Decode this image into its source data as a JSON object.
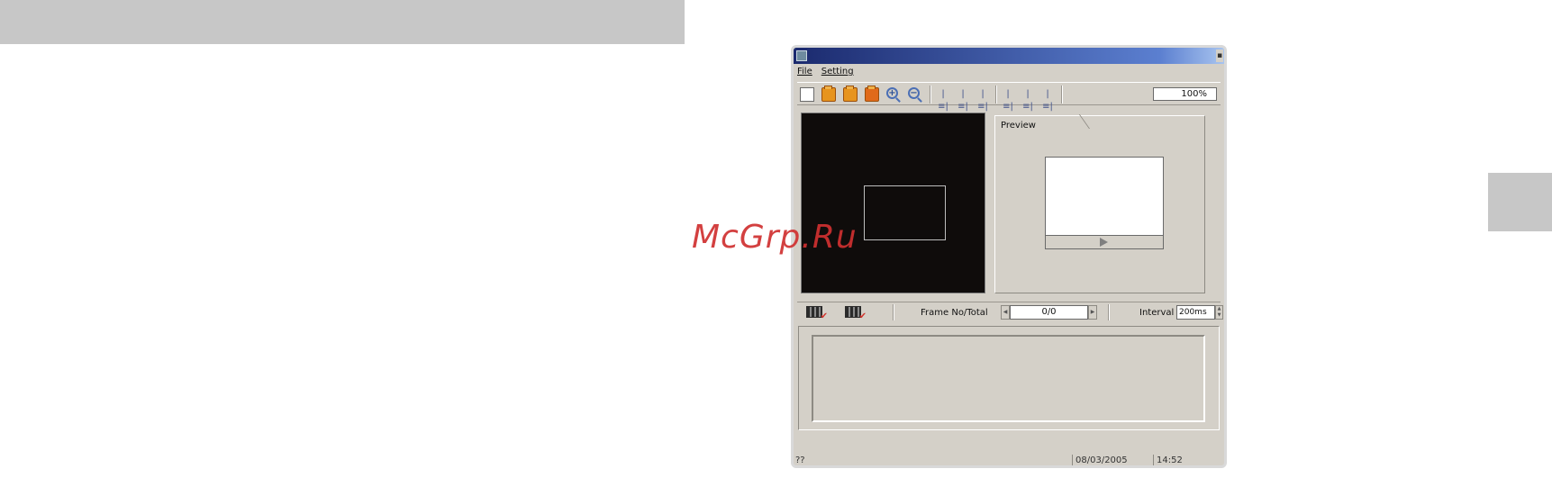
{
  "watermark": "McGrp.Ru",
  "menu": {
    "file": "File",
    "setting": "Setting"
  },
  "toolbar": {
    "zoom_in_symbol": "+",
    "zoom_out_symbol": "−",
    "align_symbol": "|≡|",
    "zoom_value": "100%"
  },
  "preview": {
    "tab_label": "Preview"
  },
  "frame_bar": {
    "frame_label": "Frame No/Total",
    "frame_value": "0/0",
    "prev_arrow": "◀",
    "next_arrow": "▶",
    "interval_label": "Interval",
    "interval_value": "200ms"
  },
  "status": {
    "left": "??",
    "date": "08/03/2005",
    "time": "14:52"
  },
  "colors": {
    "accent": "#1b2a6e",
    "canvas": "#0f0c0b",
    "chrome": "#d4d0c8"
  },
  "icons": [
    "app-icon",
    "new-file-icon",
    "open-folder-icon",
    "save-icon",
    "export-icon",
    "zoom-in-icon",
    "zoom-out-icon",
    "align-left-icon",
    "align-center-icon",
    "align-right-icon",
    "align-top-icon",
    "align-middle-icon",
    "align-bottom-icon",
    "film-add-icon",
    "film-check-icon",
    "play-icon"
  ]
}
